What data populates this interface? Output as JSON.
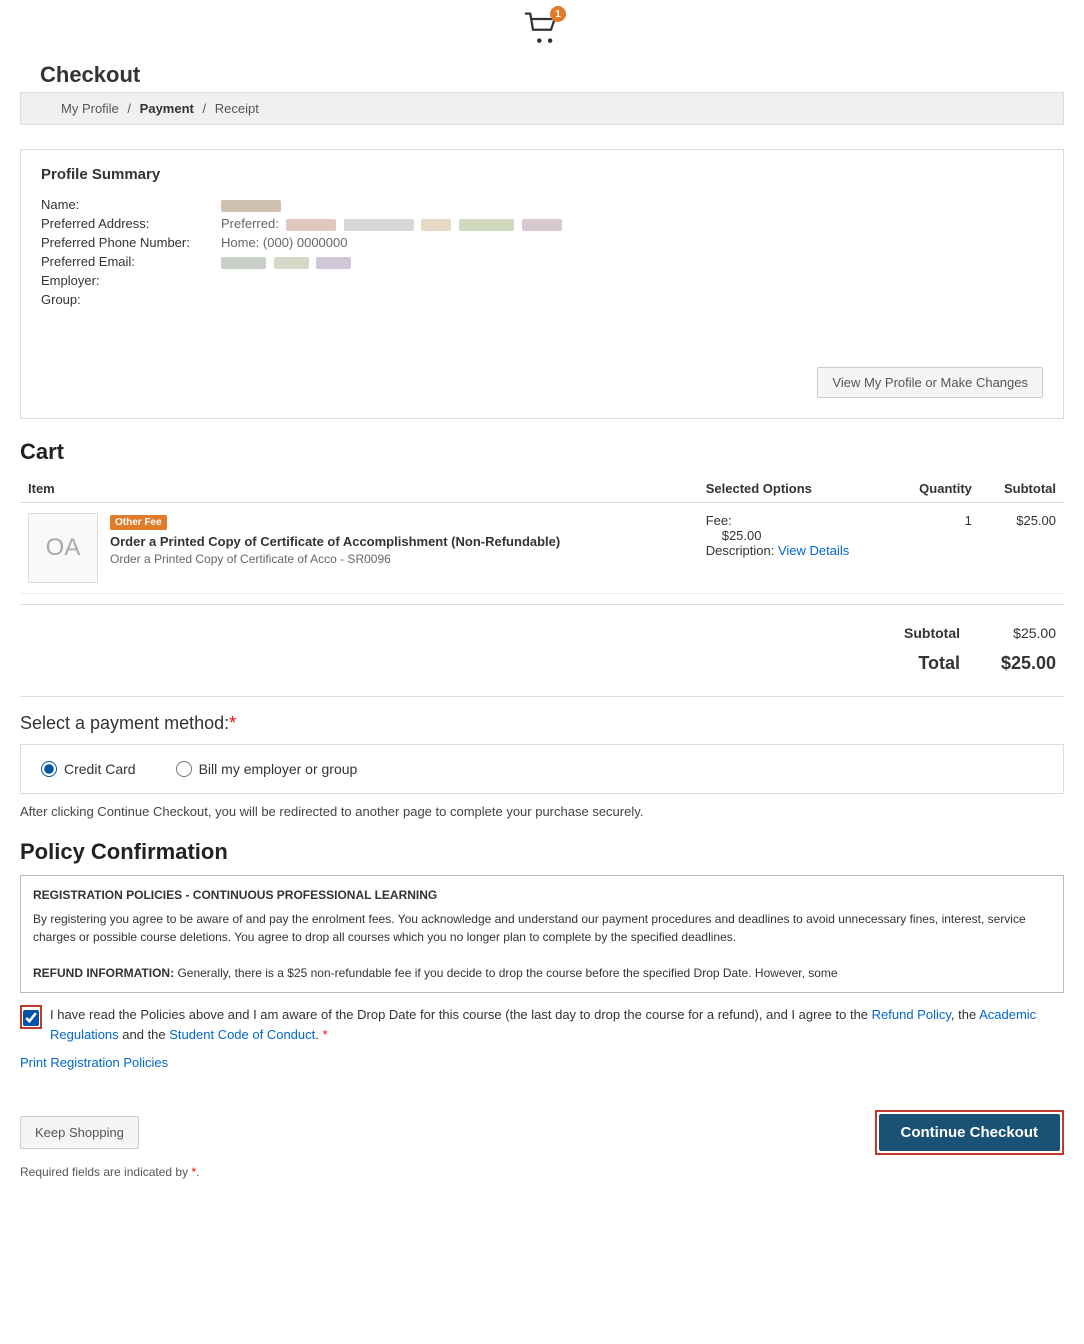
{
  "header": {
    "cart_badge": "1",
    "cart_icon_label": "Shopping Cart"
  },
  "page": {
    "title": "Checkout"
  },
  "breadcrumb": {
    "items": [
      {
        "label": "My Profile",
        "active": false
      },
      {
        "label": "Payment",
        "active": true
      },
      {
        "label": "Receipt",
        "active": false
      }
    ]
  },
  "profile_summary": {
    "title": "Profile Summary",
    "fields": [
      {
        "label": "Name:",
        "value": ""
      },
      {
        "label": "Preferred Address:",
        "value": "Preferred:"
      },
      {
        "label": "Preferred Phone Number:",
        "value": "Home: (000) 0000000"
      },
      {
        "label": "Preferred Email:",
        "value": ""
      },
      {
        "label": "Employer:",
        "value": ""
      },
      {
        "label": "Group:",
        "value": ""
      }
    ],
    "view_button_label": "View My Profile or Make Changes"
  },
  "cart": {
    "section_title": "Cart",
    "columns": {
      "item": "Item",
      "selected_options": "Selected Options",
      "quantity": "Quantity",
      "subtotal": "Subtotal"
    },
    "items": [
      {
        "thumbnail_text": "OA",
        "badge": "Other Fee",
        "name": "Order a Printed Copy of Certificate of Accomplishment (Non-Refundable)",
        "description": "Order a Printed Copy of Certificate of Acco - SR0096",
        "fee_label": "Fee:",
        "fee_amount": "$25.00",
        "desc_label": "Description:",
        "desc_link": "View Details",
        "quantity": "1",
        "subtotal": "$25.00"
      }
    ],
    "subtotal_label": "Subtotal",
    "subtotal_value": "$25.00",
    "total_label": "Total",
    "total_value": "$25.00"
  },
  "payment": {
    "section_title": "Select a payment method:",
    "required_indicator": "*",
    "options": [
      {
        "id": "credit-card",
        "label": "Credit Card",
        "checked": true
      },
      {
        "id": "bill-employer",
        "label": "Bill my employer or group",
        "checked": false
      }
    ],
    "redirect_note": "After clicking Continue Checkout, you will be redirected to another page to complete your purchase securely."
  },
  "policy": {
    "section_title": "Policy Confirmation",
    "box_header": "REGISTRATION POLICIES - CONTINUOUS PROFESSIONAL LEARNING",
    "box_text": "By registering you agree to be aware of and pay the enrolment fees. You acknowledge and understand our payment procedures and deadlines to avoid unnecessary fines, interest, service charges or possible course deletions. You agree to drop all courses which you no longer plan to complete by the specified deadlines.",
    "refund_header": "REFUND INFORMATION:",
    "refund_text": "Generally, there is a $25 non-refundable fee if you decide to drop the course before the specified Drop Date. However, some",
    "agreement_text_parts": {
      "before": "I have read the Policies above and I am aware of the Drop Date for this course (the last day to drop the course for a refund), and I agree to the ",
      "link1": "Refund Policy",
      "middle": ", the ",
      "link2": "Academic Regulations",
      "and": " and the ",
      "link3": "Student Code of Conduct",
      "end": ".",
      "required": "*"
    },
    "print_link": "Print Registration Policies"
  },
  "buttons": {
    "keep_shopping": "Keep Shopping",
    "continue_checkout": "Continue Checkout"
  },
  "required_note": "Required fields are indicated by"
}
